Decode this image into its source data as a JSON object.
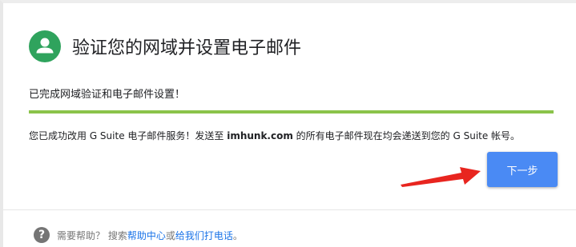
{
  "header": {
    "title": "验证您的网域并设置电子邮件",
    "icon": "user-avatar-icon",
    "accent_color": "#2fa35d"
  },
  "status": {
    "text": "已完成网域验证和电子邮件设置！"
  },
  "progress": {
    "percent": 100,
    "color": "#8bc34a"
  },
  "message": {
    "prefix": "您已成功改用 G Suite 电子邮件服务！发送至 ",
    "domain": "imhunk.com",
    "suffix": " 的所有电子邮件现在均会递送到您的 G Suite 帐号。"
  },
  "actions": {
    "next_label": "下一步",
    "next_color": "#4a8af4"
  },
  "annotation": {
    "icon": "red-arrow-icon",
    "color": "#e8251f"
  },
  "help": {
    "icon": "question-icon",
    "prefix": "需要帮助？ 搜索",
    "help_center_link": "帮助中心",
    "or": "或 ",
    "call_link": "给我们打电话",
    "suffix": "。"
  }
}
